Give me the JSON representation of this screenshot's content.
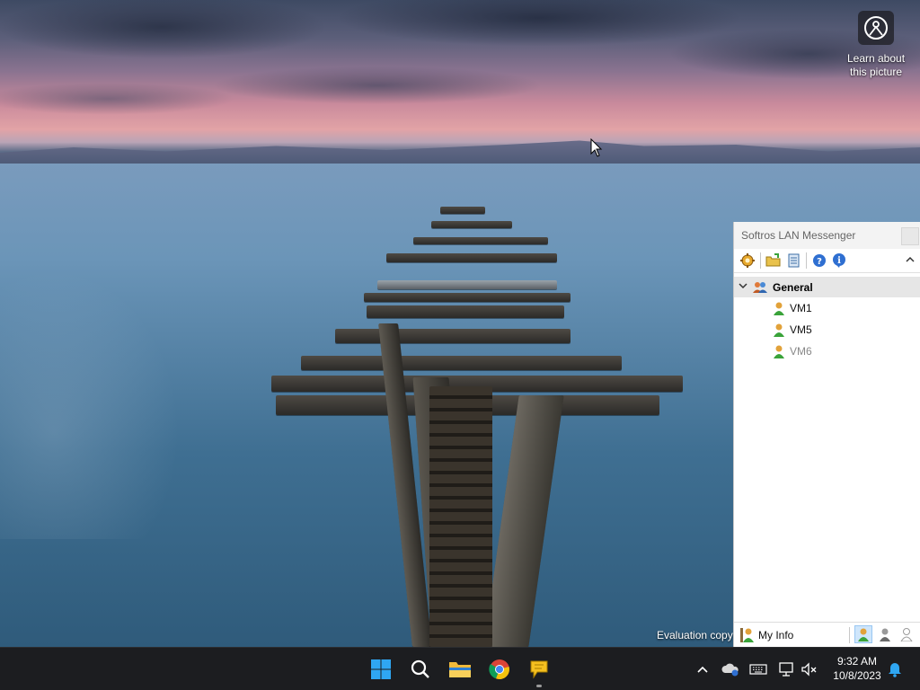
{
  "desktop": {
    "learn_label_line1": "Learn about",
    "learn_label_line2": "this picture",
    "evaluation_text": "Evaluation copy"
  },
  "messenger": {
    "title": "Softros LAN Messenger",
    "toolbar_icons": [
      "preferences-icon",
      "open-folder-icon",
      "message-history-icon",
      "help-icon",
      "about-icon"
    ],
    "group": {
      "name": "General",
      "expanded": true,
      "users": [
        {
          "name": "VM1",
          "status": "online"
        },
        {
          "name": "VM5",
          "status": "online"
        },
        {
          "name": "VM6",
          "status": "offline"
        }
      ]
    },
    "status_bar": {
      "my_info_label": "My Info",
      "selected_status": "online"
    }
  },
  "taskbar": {
    "apps": [
      "start",
      "search",
      "file-explorer",
      "chrome",
      "softros-lan-messenger"
    ],
    "clock_time": "9:32 AM",
    "clock_date": "10/8/2023"
  }
}
